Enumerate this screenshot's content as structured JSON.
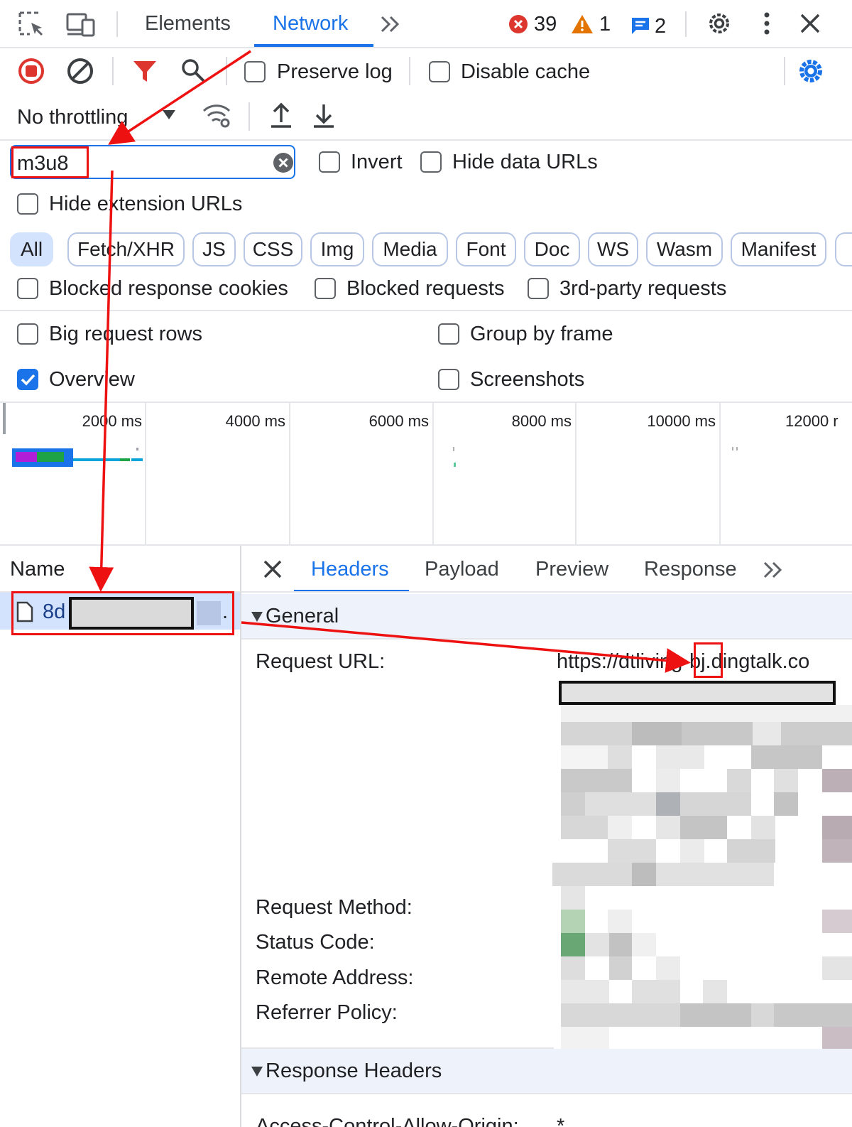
{
  "devtools": {
    "tabs": [
      "Elements",
      "Network"
    ],
    "active_tab": "Network",
    "more_tabs_glyph": "»",
    "errors_count": "39",
    "warnings_count": "1",
    "messages_count": "2"
  },
  "toolbar": {
    "preserve_log_label": "Preserve log",
    "disable_cache_label": "Disable cache",
    "throttling_value": "No throttling"
  },
  "filter": {
    "value": "m3u8",
    "invert_label": "Invert",
    "hide_data_urls_label": "Hide data URLs",
    "hide_extension_urls_label": "Hide extension URLs"
  },
  "type_filters": [
    "All",
    "Fetch/XHR",
    "JS",
    "CSS",
    "Img",
    "Media",
    "Font",
    "Doc",
    "WS",
    "Wasm",
    "Manifest"
  ],
  "active_type_filter": "All",
  "options": {
    "blocked_response_cookies": "Blocked response cookies",
    "blocked_requests": "Blocked requests",
    "third_party_requests": "3rd-party requests",
    "big_request_rows": "Big request rows",
    "group_by_frame": "Group by frame",
    "overview": "Overview",
    "overview_checked": true,
    "screenshots": "Screenshots"
  },
  "timeline_ticks": [
    "2000 ms",
    "4000 ms",
    "6000 ms",
    "8000 ms",
    "10000 ms",
    "12000 r"
  ],
  "request_list": {
    "header": "Name",
    "row_prefix": "8d",
    "row_suffix": "."
  },
  "detail_tabs": [
    "Headers",
    "Payload",
    "Preview",
    "Response"
  ],
  "active_detail_tab": "Headers",
  "general": {
    "section_title": "General",
    "request_url_label": "Request URL:",
    "request_url_value": "https://dtliving-bj.dingtalk.co",
    "request_method_label": "Request Method:",
    "status_code_label": "Status Code:",
    "remote_address_label": "Remote Address:",
    "referrer_policy_label": "Referrer Policy:"
  },
  "response_headers": {
    "section_title": "Response Headers",
    "first_header_label": "Access-Control-Allow-Origin:",
    "first_header_value": "*"
  },
  "colors": {
    "accent": "#1a73e8",
    "annotation_red": "#ee1111",
    "error_red": "#dc362e",
    "warning_orange": "#e37400"
  }
}
